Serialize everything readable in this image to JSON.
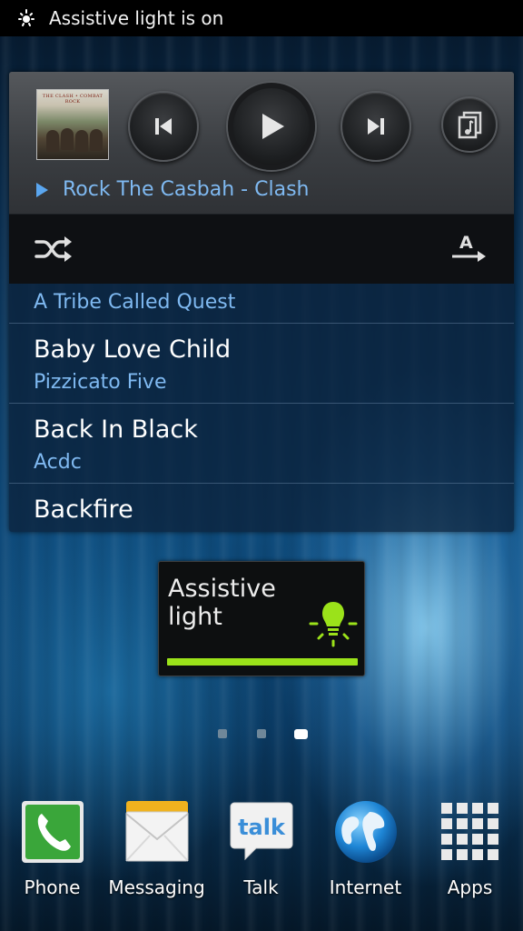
{
  "status_bar": {
    "notification_text": "Assistive light is on",
    "icon": "assistive-light-icon"
  },
  "music_widget": {
    "album_art_text": "THE CLASH • COMBAT ROCK",
    "now_playing": "Rock The Casbah - Clash",
    "controls": [
      "previous-icon",
      "play-icon",
      "next-icon",
      "playlist-icon"
    ],
    "toolbar_icons": [
      "shuffle-icon",
      "sort-alpha-icon"
    ],
    "songs": [
      {
        "title": "",
        "artist": "A Tribe Called Quest"
      },
      {
        "title": "Baby Love Child",
        "artist": "Pizzicato Five"
      },
      {
        "title": "Back In Black",
        "artist": "Acdc"
      },
      {
        "title": "Backfire",
        "artist": ""
      }
    ]
  },
  "assistive_light_widget": {
    "label": "Assistive light",
    "icon": "light-bulb-icon",
    "accent_color": "#9be21a"
  },
  "page_indicator": {
    "page_count": 3,
    "current_page": 3
  },
  "dock": {
    "items": [
      {
        "label": "Phone",
        "icon": "phone-icon"
      },
      {
        "label": "Messaging",
        "icon": "envelope-icon"
      },
      {
        "label": "Talk",
        "icon": "talk-icon"
      },
      {
        "label": "Internet",
        "icon": "globe-icon"
      },
      {
        "label": "Apps",
        "icon": "apps-grid-icon"
      }
    ]
  },
  "colors": {
    "link_blue": "#7fb9f1",
    "accent_green": "#9be21a"
  }
}
